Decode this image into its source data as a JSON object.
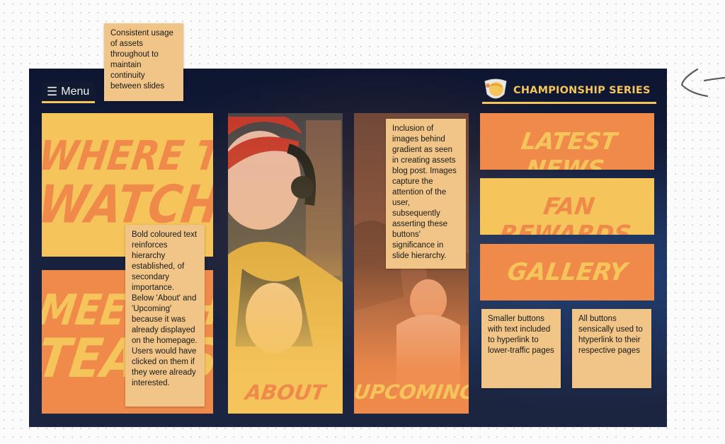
{
  "slide": {
    "menu": {
      "icon": "hamburger-icon",
      "label": "Menu"
    },
    "brand": {
      "logo": "shield-ball-logo-icon",
      "name": "CHAMPIONSHIP SERIES"
    },
    "tiles": {
      "where_to_watch": {
        "line1": "WHERE TO",
        "line2": "WATCH"
      },
      "meet_the_teams": {
        "line1": "MEET THE",
        "line2": "TEAMS"
      },
      "about": {
        "label": "ABOUT"
      },
      "upcoming": {
        "label": "UPCOMING"
      },
      "latest_news": {
        "label": "LATEST NEWS"
      },
      "fan_rewards": {
        "label": "FAN REWARDS"
      },
      "gallery": {
        "label": "GALLERY"
      }
    }
  },
  "notes": {
    "assets": "Consistent usage of assets throughout to maintain continuity between slides",
    "bold_text": "Bold coloured text reinforces hierarchy established, of secondary importance. Below 'About' and 'Upcoming' because it was already displayed on the homepage. Users would have clicked on them if they were already interested.",
    "gradient": "Inclusion of images behind gradient as seen in creating assets blog post. Images capture the attention of the user, subsequently asserting these buttons' significance in slide hierarchy.",
    "smaller": "Smaller buttons with text included to hyperlink to lower-traffic pages",
    "all_buttons": "All buttons sensically used to htyperlink to their respective pages"
  },
  "colors": {
    "yellow": "#f5c45a",
    "orange": "#f08a4b",
    "navy": "#0d1530",
    "sticky": "#f0c587"
  }
}
